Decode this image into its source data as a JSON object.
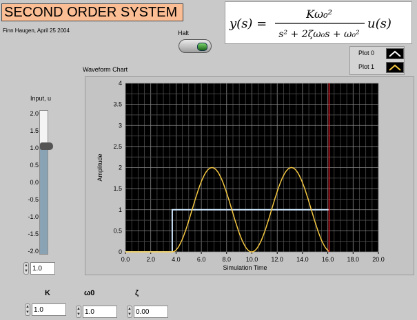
{
  "title": "SECOND ORDER SYSTEM",
  "author": "Finn Haugen, April 25 2004",
  "equation": {
    "lhs": "y(s) =",
    "numerator": "Kω₀²",
    "denominator": "s² + 2ζω₀s + ω₀²",
    "rhs": "u(s)"
  },
  "halt": {
    "label": "Halt"
  },
  "legend": {
    "items": [
      {
        "label": "Plot 0",
        "color": "#ffffff"
      },
      {
        "label": "Plot 1",
        "color": "#f5c842"
      }
    ]
  },
  "input": {
    "label": "Input, u",
    "scale": [
      "2.0",
      "1.5",
      "1.0",
      "0.5",
      "0.0",
      "-0.5",
      "-1.0",
      "-1.5",
      "-2.0"
    ],
    "value": 1.0,
    "min": -2.0,
    "max": 2.0,
    "value_text": "1.0"
  },
  "params": [
    {
      "label": "K",
      "value": "1.0"
    },
    {
      "label": "ω0",
      "value": "1.0"
    },
    {
      "label": "ζ",
      "value": "0.00"
    }
  ],
  "chart_title": "Waveform Chart",
  "chart_data": {
    "type": "line",
    "xlabel": "Simulation Time",
    "ylabel": "Amplitude",
    "xlim": [
      0,
      20
    ],
    "ylim": [
      0,
      4
    ],
    "x_ticks": [
      "0.0",
      "2.0",
      "4.0",
      "6.0",
      "8.0",
      "10.0",
      "12.0",
      "14.0",
      "16.0",
      "18.0",
      "20.0"
    ],
    "y_ticks": [
      "0",
      "0.5",
      "1",
      "1.5",
      "2",
      "2.5",
      "3",
      "3.5",
      "4"
    ],
    "grid": true,
    "cursor_x": 16.1,
    "step_time": 3.7,
    "series": [
      {
        "name": "Plot 0",
        "color": "#cfe8ff",
        "kind": "step",
        "x_start": 0,
        "x_end": 16.1,
        "before": 0,
        "after": 1
      },
      {
        "name": "Plot 1",
        "color": "#f5c842",
        "kind": "second_order",
        "x_start": 0,
        "x_end": 16.1,
        "K": 1.0,
        "omega0": 1.0,
        "zeta": 0.0,
        "u": 1.0
      }
    ]
  }
}
